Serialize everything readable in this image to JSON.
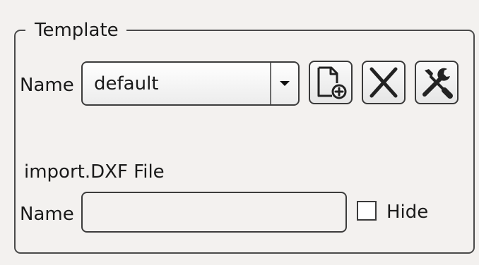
{
  "template": {
    "legend": "Template",
    "name_label": "Name",
    "name_value": "default",
    "buttons": {
      "new_icon": "new-document-icon",
      "delete_icon": "delete-x-icon",
      "edit_icon": "tools-icon"
    }
  },
  "import": {
    "section_label": "import.DXF File",
    "name_label": "Name",
    "name_value": "",
    "hide_label": "Hide",
    "hide_checked": false
  }
}
